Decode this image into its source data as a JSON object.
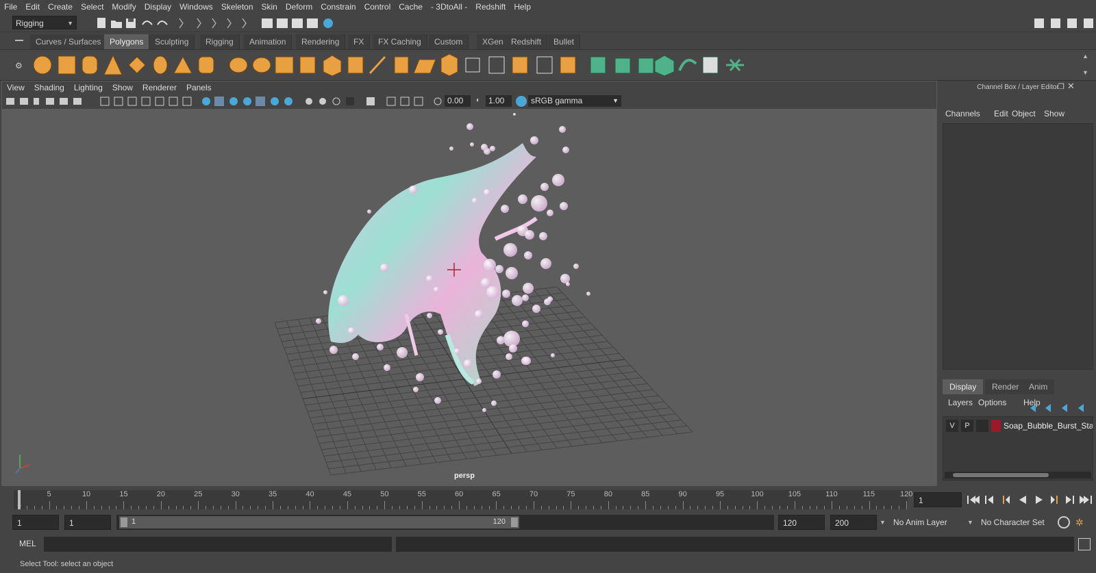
{
  "menubar": {
    "items": [
      "File",
      "Edit",
      "Create",
      "Select",
      "Modify",
      "Display",
      "Windows",
      "Skeleton",
      "Skin",
      "Deform",
      "Constrain",
      "Control",
      "Cache",
      "- 3DtoAll -",
      "Redshift",
      "Help"
    ]
  },
  "statusline": {
    "menuset": "Rigging"
  },
  "shelf": {
    "tabs": [
      "Curves / Surfaces",
      "Polygons",
      "Sculpting",
      "Rigging",
      "Animation",
      "Rendering",
      "FX",
      "FX Caching",
      "Custom",
      "XGen",
      "Redshift",
      "Bullet"
    ],
    "active_tab": "Polygons"
  },
  "viewport": {
    "menu": [
      "View",
      "Shading",
      "Lighting",
      "Show",
      "Renderer",
      "Panels"
    ],
    "exposure": "0.00",
    "gamma": "1.00",
    "colorspace": "sRGB gamma",
    "camera_label": "persp"
  },
  "channel_box": {
    "title": "Channel Box / Layer Editor",
    "menu": [
      "Channels",
      "Edit",
      "Object",
      "Show"
    ]
  },
  "layer_editor": {
    "tabs": [
      "Display",
      "Render",
      "Anim"
    ],
    "active_tab": "Display",
    "menu": [
      "Layers",
      "Options",
      "Help"
    ],
    "layers": [
      {
        "v": "V",
        "p": "P",
        "name": "Soap_Bubble_Burst_Stag",
        "color": "#9a1a2a"
      }
    ]
  },
  "timeline": {
    "first_label": "1",
    "ticks": [
      "5",
      "10",
      "15",
      "20",
      "25",
      "30",
      "35",
      "40",
      "45",
      "50",
      "55",
      "60",
      "65",
      "70",
      "75",
      "80",
      "85",
      "90",
      "95",
      "100",
      "105",
      "110",
      "115",
      "120"
    ],
    "current_frame": "1"
  },
  "range": {
    "start": "1",
    "playback_start": "1",
    "slider_start": "1",
    "slider_end": "120",
    "playback_end": "120",
    "end": "200",
    "anim_layer": "No Anim Layer",
    "character_set": "No Character Set"
  },
  "command": {
    "label": "MEL"
  },
  "help_line": {
    "text": "Select Tool: select an object"
  },
  "colors": {
    "accent": "#5d5d5d",
    "shelf_orange": "#e8a040",
    "shelf_green": "#4fb28a",
    "layer_red": "#9a1a2a"
  }
}
